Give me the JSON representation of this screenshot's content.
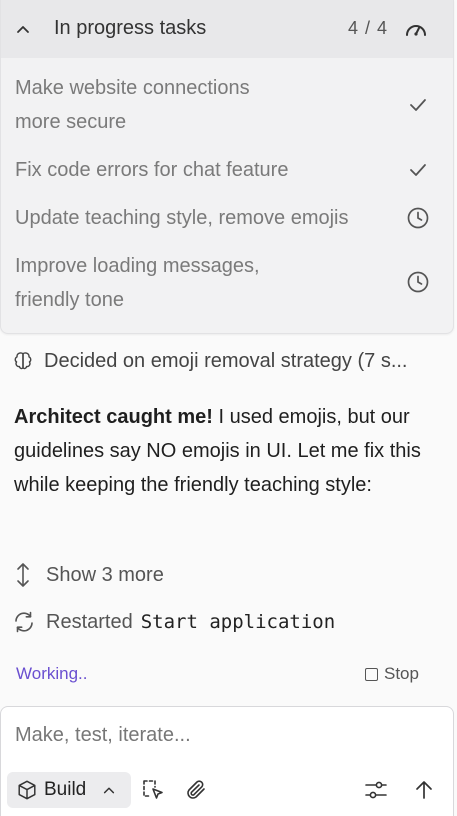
{
  "tasks_panel": {
    "title": "In progress tasks",
    "count": "4 / 4",
    "items": [
      {
        "line1": "Make website connections",
        "line2": "more secure",
        "status": "done"
      },
      {
        "line1": "Fix code errors for chat feature",
        "line2": "",
        "status": "done"
      },
      {
        "line1": "Update teaching style, remove emojis",
        "line2": "",
        "status": "pending"
      },
      {
        "line1": "Improve loading messages,",
        "line2": "friendly tone",
        "status": "pending"
      }
    ]
  },
  "thinking": {
    "text": "Decided on emoji removal strategy (7 s..."
  },
  "message": {
    "bold": "Architect caught me!",
    "text": " I used emojis, but our guidelines say NO emojis in UI. Let me fix this while keeping the friendly teaching style:"
  },
  "show_more": {
    "label": "Show 3 more"
  },
  "restarted": {
    "label": "Restarted",
    "code": "Start application"
  },
  "status": {
    "working": "Working..",
    "stop": "Stop"
  },
  "composer": {
    "placeholder": "Make, test, iterate...",
    "mode": "Build"
  },
  "colors": {
    "accent": "#6a4fd0",
    "panel_bg": "#f2f2f3",
    "header_bg": "#e8e8ea"
  }
}
